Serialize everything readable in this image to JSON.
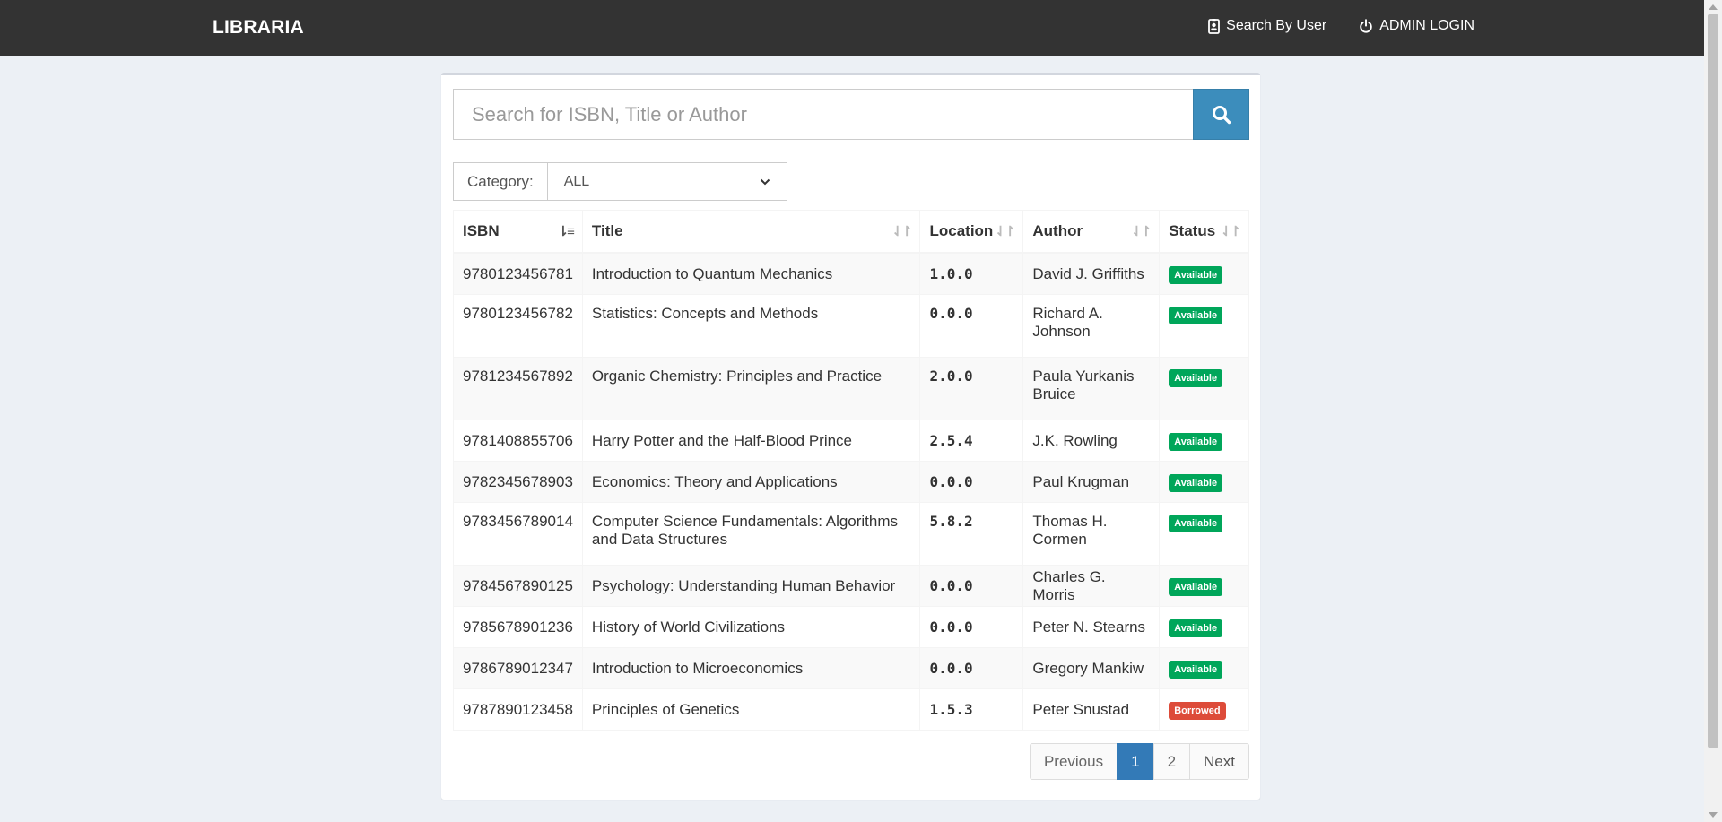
{
  "nav": {
    "brand": "LIBRARIA",
    "search_by_user": "Search By User",
    "admin_login": "ADMIN LOGIN"
  },
  "search": {
    "placeholder": "Search for ISBN, Title or Author",
    "button_icon": "search-icon"
  },
  "filter": {
    "label": "Category:",
    "selected": "ALL"
  },
  "table": {
    "headers": {
      "isbn": "ISBN",
      "title": "Title",
      "location": "Location",
      "author": "Author",
      "status": "Status"
    },
    "rows": [
      {
        "isbn": "9780123456781",
        "title": "Introduction to Quantum Mechanics",
        "location": "1.0.0",
        "author": "David J. Griffiths",
        "status": "Available"
      },
      {
        "isbn": "9780123456782",
        "title": "Statistics: Concepts and Methods",
        "location": "0.0.0",
        "author": "Richard A. Johnson",
        "status": "Available"
      },
      {
        "isbn": "9781234567892",
        "title": "Organic Chemistry: Principles and Practice",
        "location": "2.0.0",
        "author": "Paula Yurkanis Bruice",
        "status": "Available"
      },
      {
        "isbn": "9781408855706",
        "title": "Harry Potter and the Half-Blood Prince",
        "location": "2.5.4",
        "author": "J.K. Rowling",
        "status": "Available"
      },
      {
        "isbn": "9782345678903",
        "title": "Economics: Theory and Applications",
        "location": "0.0.0",
        "author": "Paul Krugman",
        "status": "Available"
      },
      {
        "isbn": "9783456789014",
        "title": "Computer Science Fundamentals: Algorithms and Data Structures",
        "location": "5.8.2",
        "author": "Thomas H. Cormen",
        "status": "Available"
      },
      {
        "isbn": "9784567890125",
        "title": "Psychology: Understanding Human Behavior",
        "location": "0.0.0",
        "author": "Charles G. Morris",
        "status": "Available"
      },
      {
        "isbn": "9785678901236",
        "title": "History of World Civilizations",
        "location": "0.0.0",
        "author": "Peter N. Stearns",
        "status": "Available"
      },
      {
        "isbn": "9786789012347",
        "title": "Introduction to Microeconomics",
        "location": "0.0.0",
        "author": "Gregory Mankiw",
        "status": "Available"
      },
      {
        "isbn": "9787890123458",
        "title": "Principles of Genetics",
        "location": "1.5.3",
        "author": "Peter Snustad",
        "status": "Borrowed"
      }
    ]
  },
  "pagination": {
    "previous": "Previous",
    "pages": [
      "1",
      "2"
    ],
    "next": "Next"
  },
  "colors": {
    "navbar": "#333333",
    "accent": "#3c8dbc",
    "available": "#00a65a",
    "borrowed": "#dd4b39"
  }
}
